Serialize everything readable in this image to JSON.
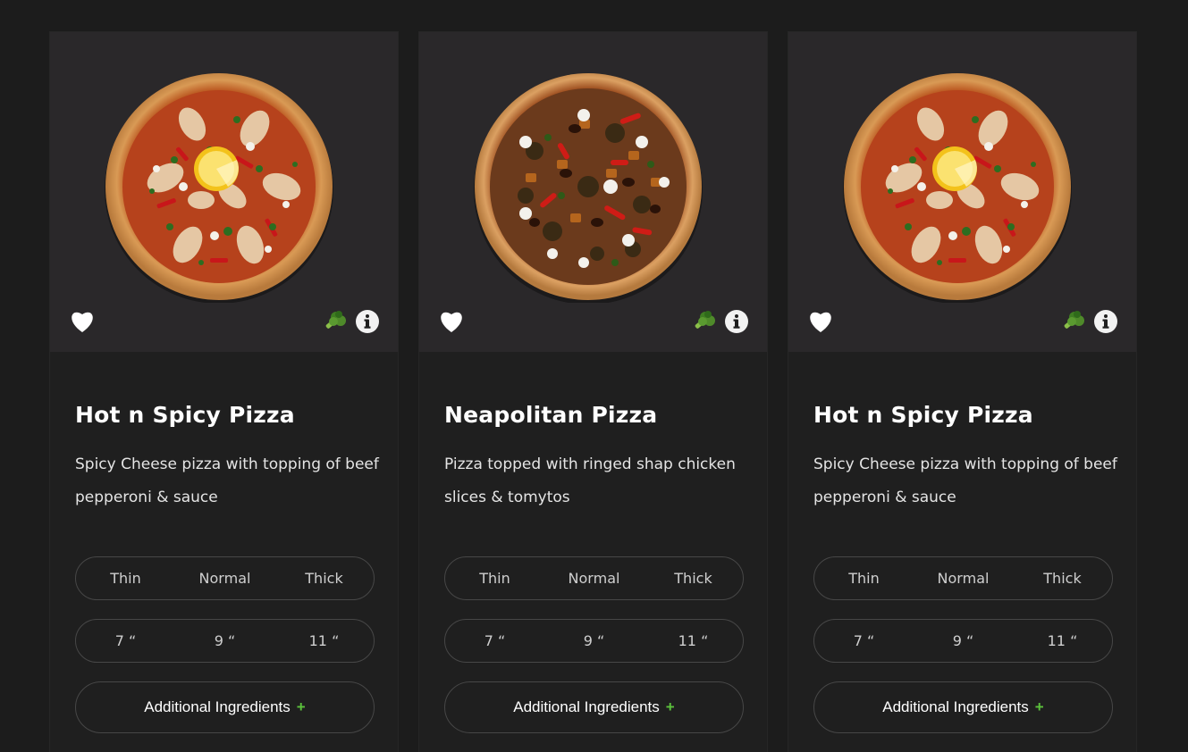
{
  "colors": {
    "background": "#1c1c1c",
    "card": "#1f1f1f",
    "media": "#2a282a",
    "accent_plus": "#5cc23c",
    "veg_icon": "#4f8a2a"
  },
  "cards": [
    {
      "title": "Hot n Spicy Pizza",
      "description": "Spicy Cheese pizza with topping of beef pepperoni & sauce",
      "image": "pizza-lemon-chicken",
      "crust_options": [
        "Thin",
        "Normal",
        "Thick"
      ],
      "size_options": [
        "7 “",
        "9 “",
        "11 “"
      ],
      "additional_label": "Additional Ingredients",
      "plus": "+"
    },
    {
      "title": "Neapolitan Pizza",
      "description": "Pizza topped with ringed shap chicken slices & tomytos",
      "image": "pizza-olive-veggie",
      "crust_options": [
        "Thin",
        "Normal",
        "Thick"
      ],
      "size_options": [
        "7 “",
        "9 “",
        "11 “"
      ],
      "additional_label": "Additional Ingredients",
      "plus": "+"
    },
    {
      "title": "Hot n Spicy Pizza",
      "description": "Spicy Cheese pizza with topping of beef pepperoni & sauce",
      "image": "pizza-lemon-chicken",
      "crust_options": [
        "Thin",
        "Normal",
        "Thick"
      ],
      "size_options": [
        "7 “",
        "9 “",
        "11 “"
      ],
      "additional_label": "Additional Ingredients",
      "plus": "+"
    }
  ]
}
